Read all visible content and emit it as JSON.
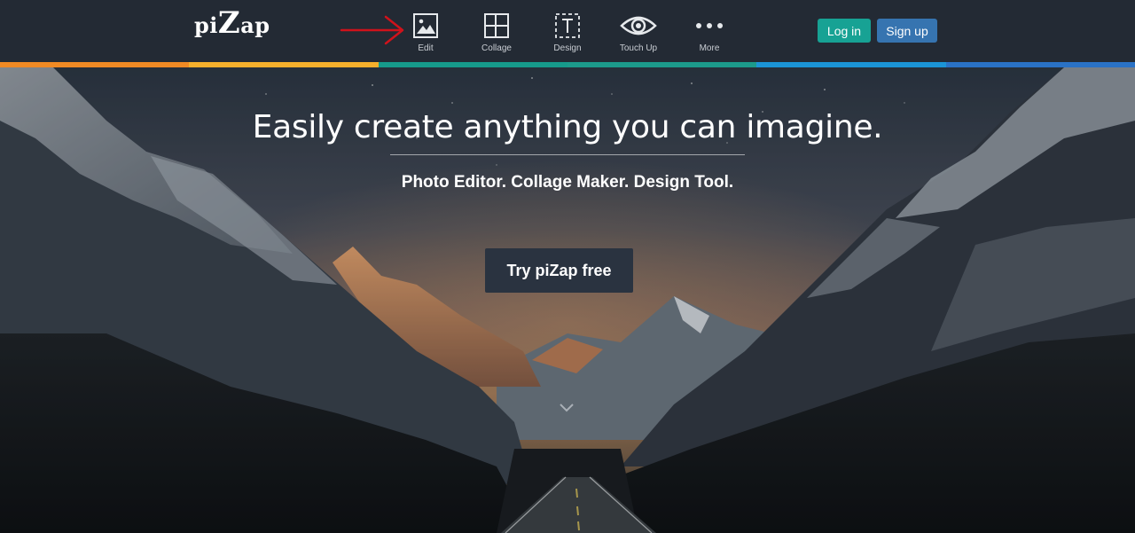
{
  "header": {
    "logo": {
      "part1": "pi",
      "part2": "Z",
      "part3": "ap"
    },
    "nav": [
      {
        "label": "Edit",
        "icon": "image-icon"
      },
      {
        "label": "Collage",
        "icon": "collage-grid-icon"
      },
      {
        "label": "Design",
        "icon": "text-frame-icon"
      },
      {
        "label": "Touch Up",
        "icon": "eye-icon"
      },
      {
        "label": "More",
        "icon": "more-dots-icon"
      }
    ],
    "login_label": "Log in",
    "signup_label": "Sign up"
  },
  "strip_colors": [
    "#f08a24",
    "#f6b02c",
    "#169a8b",
    "#1c9a8b",
    "#1b94d6",
    "#2a72c6"
  ],
  "hero": {
    "headline": "Easily create anything you can imagine.",
    "tagline": "Photo Editor. Collage Maker. Design Tool.",
    "cta_label": "Try piZap free"
  },
  "colors": {
    "header_bg": "#232a34",
    "login_bg": "#17a294",
    "signup_bg": "#3674b0",
    "arrow": "#d0121b"
  }
}
